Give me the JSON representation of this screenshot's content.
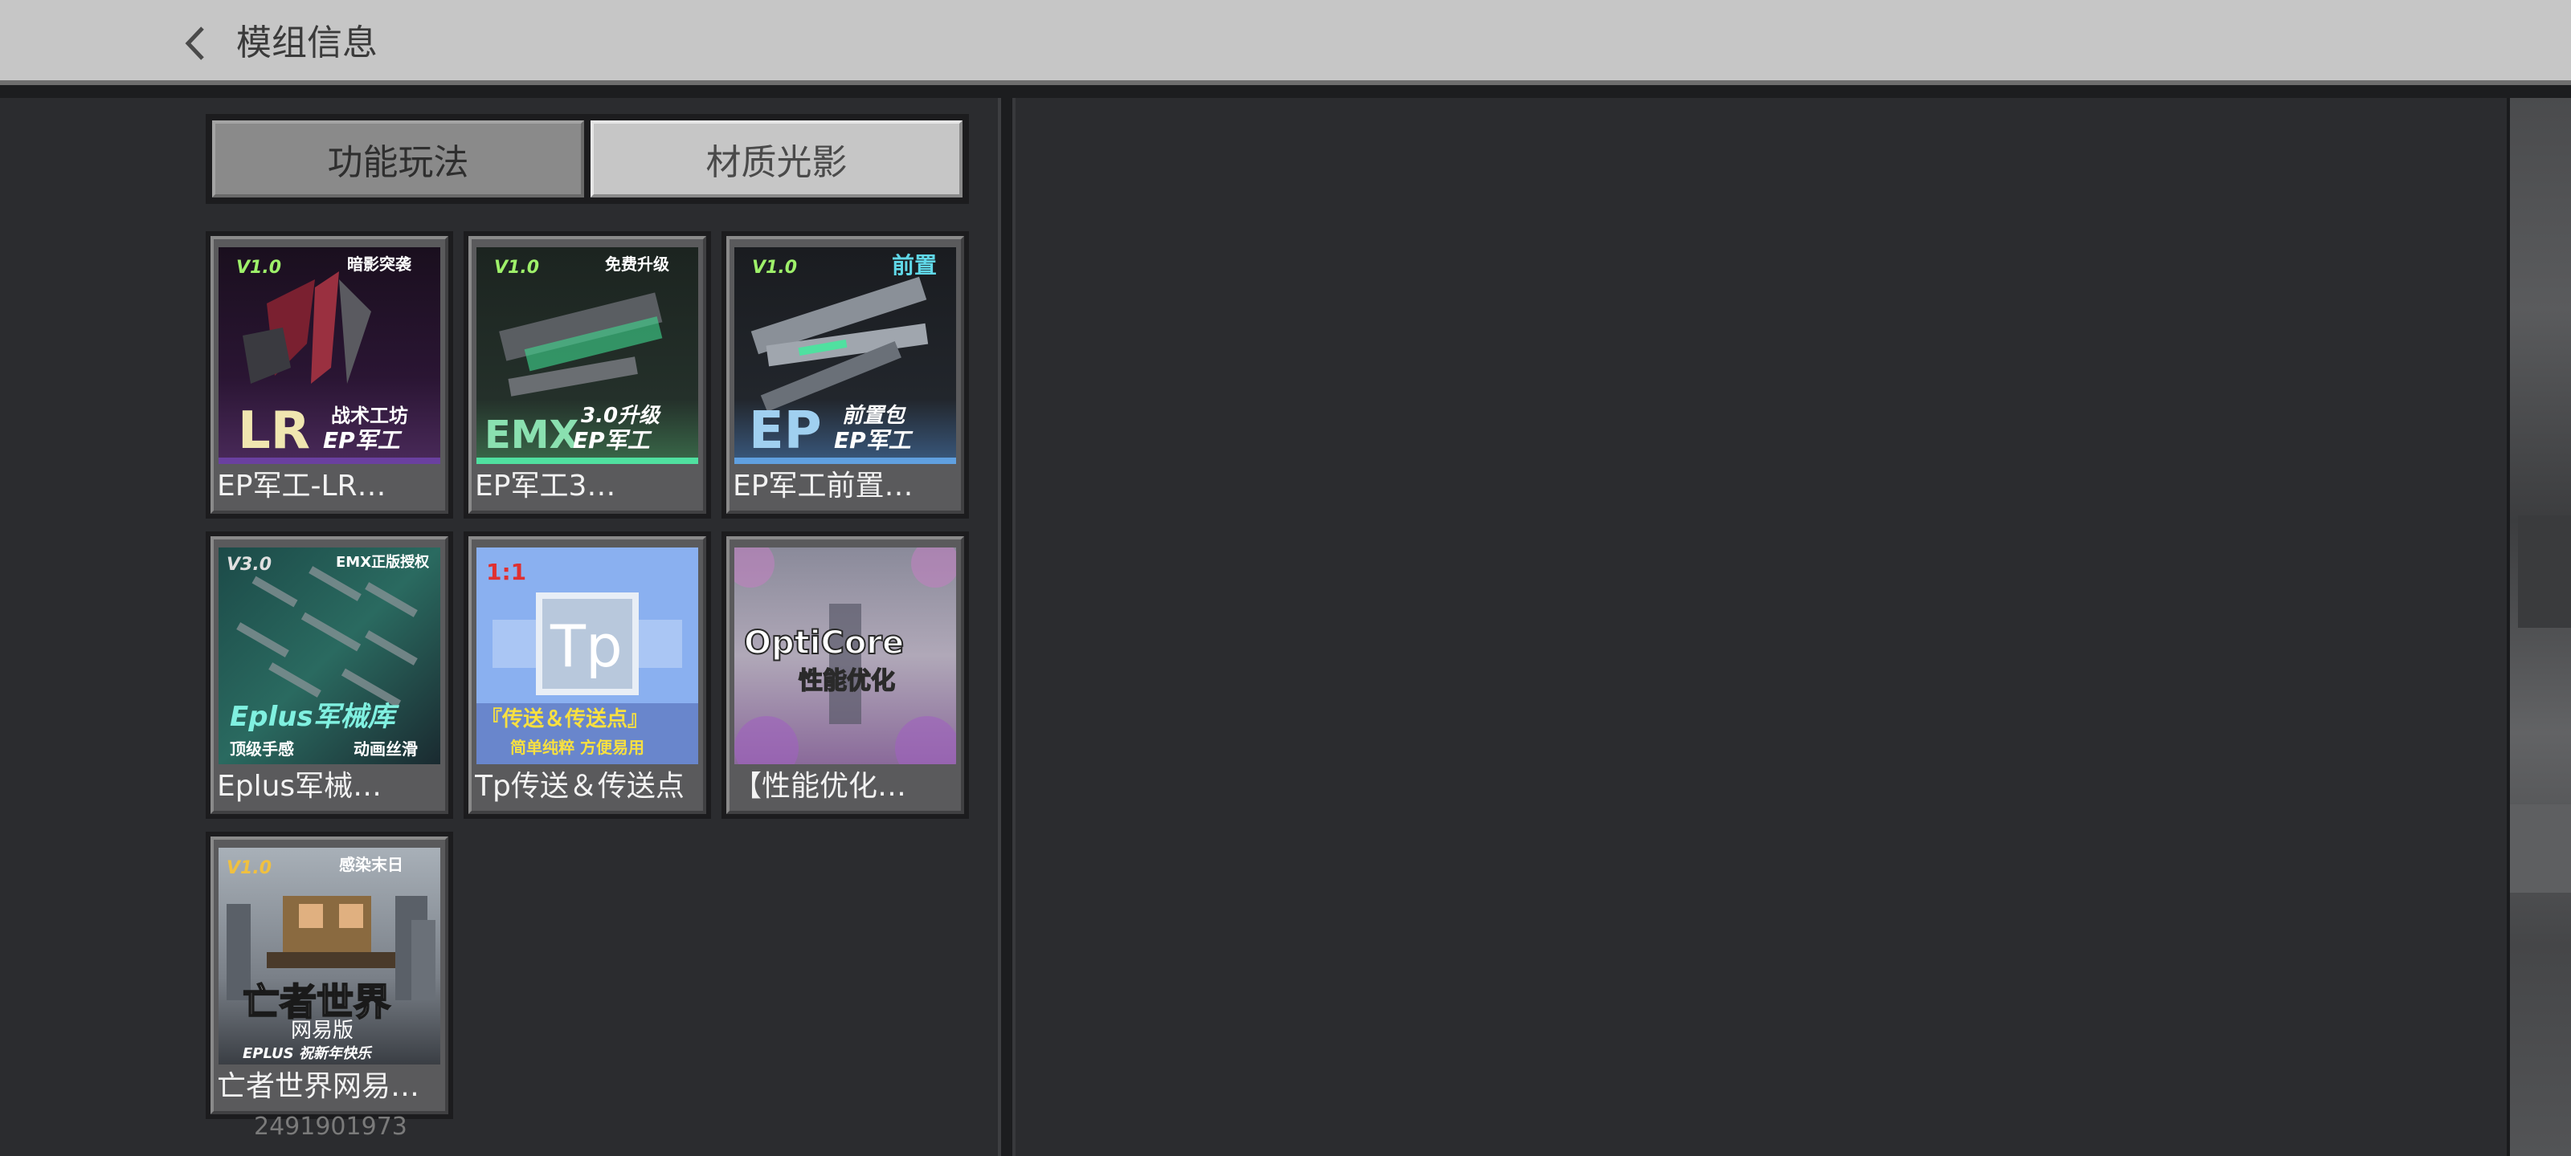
{
  "header": {
    "title": "模组信息"
  },
  "tabs": [
    {
      "label": "功能玩法",
      "active": true
    },
    {
      "label": "材质光影",
      "active": false
    }
  ],
  "mods": [
    {
      "label": "EP军工-LR…",
      "thumb": {
        "version": "V1.0",
        "tag": "暗影突袭",
        "big": "LR",
        "line1": "战术工坊",
        "line2": "EP军工"
      }
    },
    {
      "label": "EP军工3…",
      "thumb": {
        "version": "V1.0",
        "tag": "免费升级",
        "big": "EMX",
        "line1": "3.0升级",
        "line2": "EP军工"
      }
    },
    {
      "label": "EP军工前置…",
      "thumb": {
        "version": "V1.0",
        "tag": "前置",
        "big": "EP",
        "line1": "前置包",
        "line2": "EP军工"
      }
    },
    {
      "label": "Eplus军械…",
      "thumb": {
        "version": "V3.0",
        "tag": "EMX正版授权",
        "big": "Eplus军械库",
        "line1": "顶级手感",
        "line2": "动画丝滑"
      }
    },
    {
      "label": "Tp传送＆传送点",
      "thumb": {
        "version": "1:1",
        "big": "Tp",
        "line1": "『传送＆传送点』",
        "line2": "简单纯粹 方便易用"
      }
    },
    {
      "label": "【性能优化…",
      "thumb": {
        "big": "OptiCore",
        "line1": "性能优化"
      }
    },
    {
      "label": "亡者世界网易…",
      "thumb": {
        "version": "V1.0",
        "tag": "感染末日",
        "big": "亡者世界",
        "line1": "网易版",
        "line2": "EPLUS 祝新年快乐"
      }
    }
  ],
  "footer": {
    "id": "2491901973"
  },
  "colors": {
    "background": "#2b2c2f",
    "header": "#c6c6c6",
    "tab_active": "#8a8a8a",
    "tab_inactive": "#c6c6c6"
  }
}
